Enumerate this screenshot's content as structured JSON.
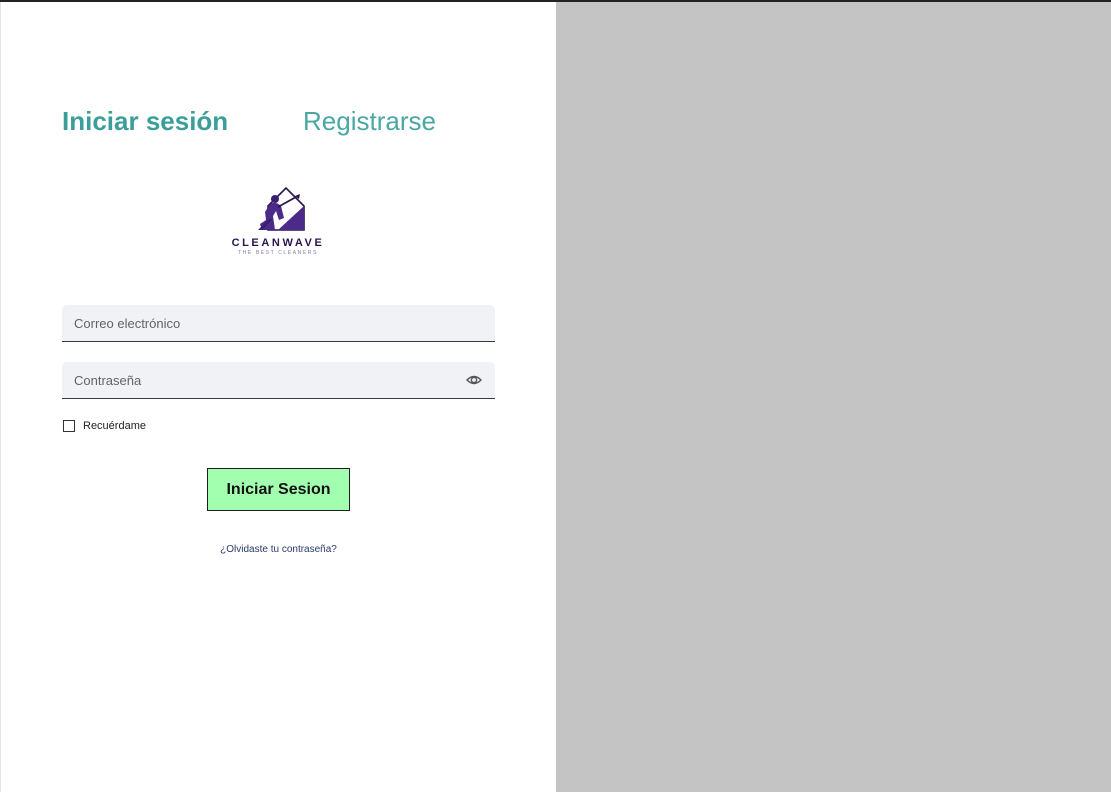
{
  "tabs": {
    "login": "Iniciar sesión",
    "register": "Registrarse"
  },
  "logo": {
    "name": "CLEANWAVE",
    "tagline": "THE BEST CLEANERS",
    "icon": "cleaner-with-pressure-washer-house-icon"
  },
  "form": {
    "email_placeholder": "Correo electrónico",
    "email_value": "",
    "password_placeholder": "Contraseña",
    "password_value": "",
    "password_toggle_icon": "eye-icon",
    "remember_label": "Recuérdame",
    "remember_checked": false,
    "submit_label": "Iniciar Sesion",
    "forgot_link": "¿Olvidaste tu contraseña?"
  },
  "colors": {
    "tab_active": "#3c9e9a",
    "tab_inactive": "#4aa7a3",
    "submit_bg": "#a3ffb0",
    "field_bg": "#f1f2f5",
    "side_panel": "#c4c4c4",
    "logo_primary": "#4b2a8a"
  }
}
